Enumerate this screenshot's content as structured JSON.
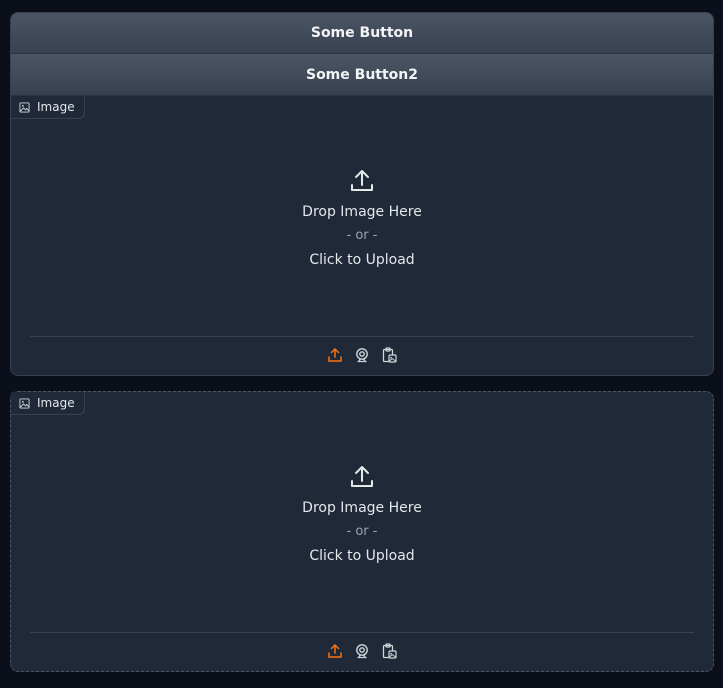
{
  "buttons": {
    "button1_label": "Some Button",
    "button2_label": "Some Button2"
  },
  "image_component_1": {
    "label": "Image",
    "drop_text": "Drop Image Here",
    "or_text": "- or -",
    "click_text": "Click to Upload",
    "toolbar_icons": [
      "upload-icon",
      "webcam-icon",
      "clipboard-icon"
    ]
  },
  "image_component_2": {
    "label": "Image",
    "drop_text": "Drop Image Here",
    "or_text": "- or -",
    "click_text": "Click to Upload",
    "toolbar_icons": [
      "upload-icon",
      "webcam-icon",
      "clipboard-icon"
    ]
  },
  "colors": {
    "background": "#0b0f19",
    "panel": "#1f2937",
    "accent": "#f97316",
    "border": "#374151"
  }
}
